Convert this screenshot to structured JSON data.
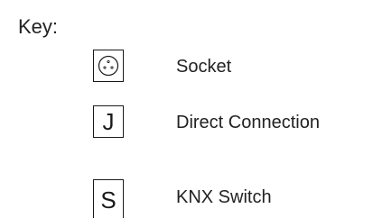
{
  "legend": {
    "title": "Key:",
    "items": [
      {
        "symbol": "socket-icon",
        "symbol_text": "",
        "label": "Socket"
      },
      {
        "symbol": "letter",
        "symbol_text": "J",
        "label": "Direct Connection"
      },
      {
        "symbol": "letter",
        "symbol_text": "S",
        "label": "KNX Switch"
      }
    ]
  }
}
